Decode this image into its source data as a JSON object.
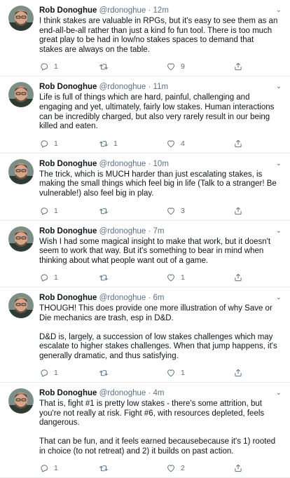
{
  "tweets": [
    {
      "name": "Rob Donoghue",
      "handle": "@rdonoghue",
      "dot": "·",
      "time": "12m",
      "paragraphs": [
        "I think stakes are valuable in RPGs, but it's easy to see them as an end-all-be-all rather than just a kind fo fun tool.  There  is too much great play to be had in low/no stakes spaces to demand that stakes are always on the table."
      ],
      "replies": "1",
      "retweets": "",
      "likes": "9"
    },
    {
      "name": "Rob Donoghue",
      "handle": "@rdonoghue",
      "dot": "·",
      "time": "11m",
      "paragraphs": [
        "Life is full of things which are hard, painful, challenging and engaging and yet, ultimately, fairly low stakes.  Human interactions can be incredibly charged, but also very rarely result in our being killed and eaten."
      ],
      "replies": "1",
      "retweets": "1",
      "likes": "4"
    },
    {
      "name": "Rob Donoghue",
      "handle": "@rdonoghue",
      "dot": "·",
      "time": "10m",
      "paragraphs": [
        "The trick, which is MUCH harder than just escalating stakes, is making the small things which feel big in life (Talk to a stranger! Be vulnerable!) also feel big in play."
      ],
      "replies": "1",
      "retweets": "",
      "likes": "3"
    },
    {
      "name": "Rob Donoghue",
      "handle": "@rdonoghue",
      "dot": "·",
      "time": "7m",
      "paragraphs": [
        "Wish I had some magical insight to make that work, but it doesn't seem to work that way.  But it's something to bear in mind when thinking about what people want out of a game."
      ],
      "replies": "1",
      "retweets": "",
      "likes": "1"
    },
    {
      "name": "Rob Donoghue",
      "handle": "@rdonoghue",
      "dot": "·",
      "time": "6m",
      "paragraphs": [
        "THOUGH!  This does provide one more illustration of why Save or Die mechanics are trash, esp in D&D.",
        "D&D is, largely, a succession of low stakes challenges which may escalate to higher stakes challenges.  When that jump happens, it's generally dramatic, and thus satisfying."
      ],
      "replies": "1",
      "retweets": "",
      "likes": "1"
    },
    {
      "name": "Rob Donoghue",
      "handle": "@rdonoghue",
      "dot": "·",
      "time": "4m",
      "paragraphs": [
        "That is, fight #1 is pretty low stakes - there's some attrition, but you're not really at risk.  Fight #6, with resources depleted, feels dangerous.",
        "That can be fun, and it feels earned becausebecause it's 1) rooted in choice (to not retreat) and 2) it builds on past action."
      ],
      "replies": "1",
      "retweets": "",
      "likes": "2"
    }
  ],
  "icons": {
    "reply": "reply-icon",
    "retweet": "retweet-icon",
    "like": "heart-icon",
    "share": "share-icon",
    "caret": "chevron-down-icon"
  },
  "colors": {
    "text": "#0f1419",
    "secondary": "#5b7083",
    "divider": "#e6ecf0"
  }
}
